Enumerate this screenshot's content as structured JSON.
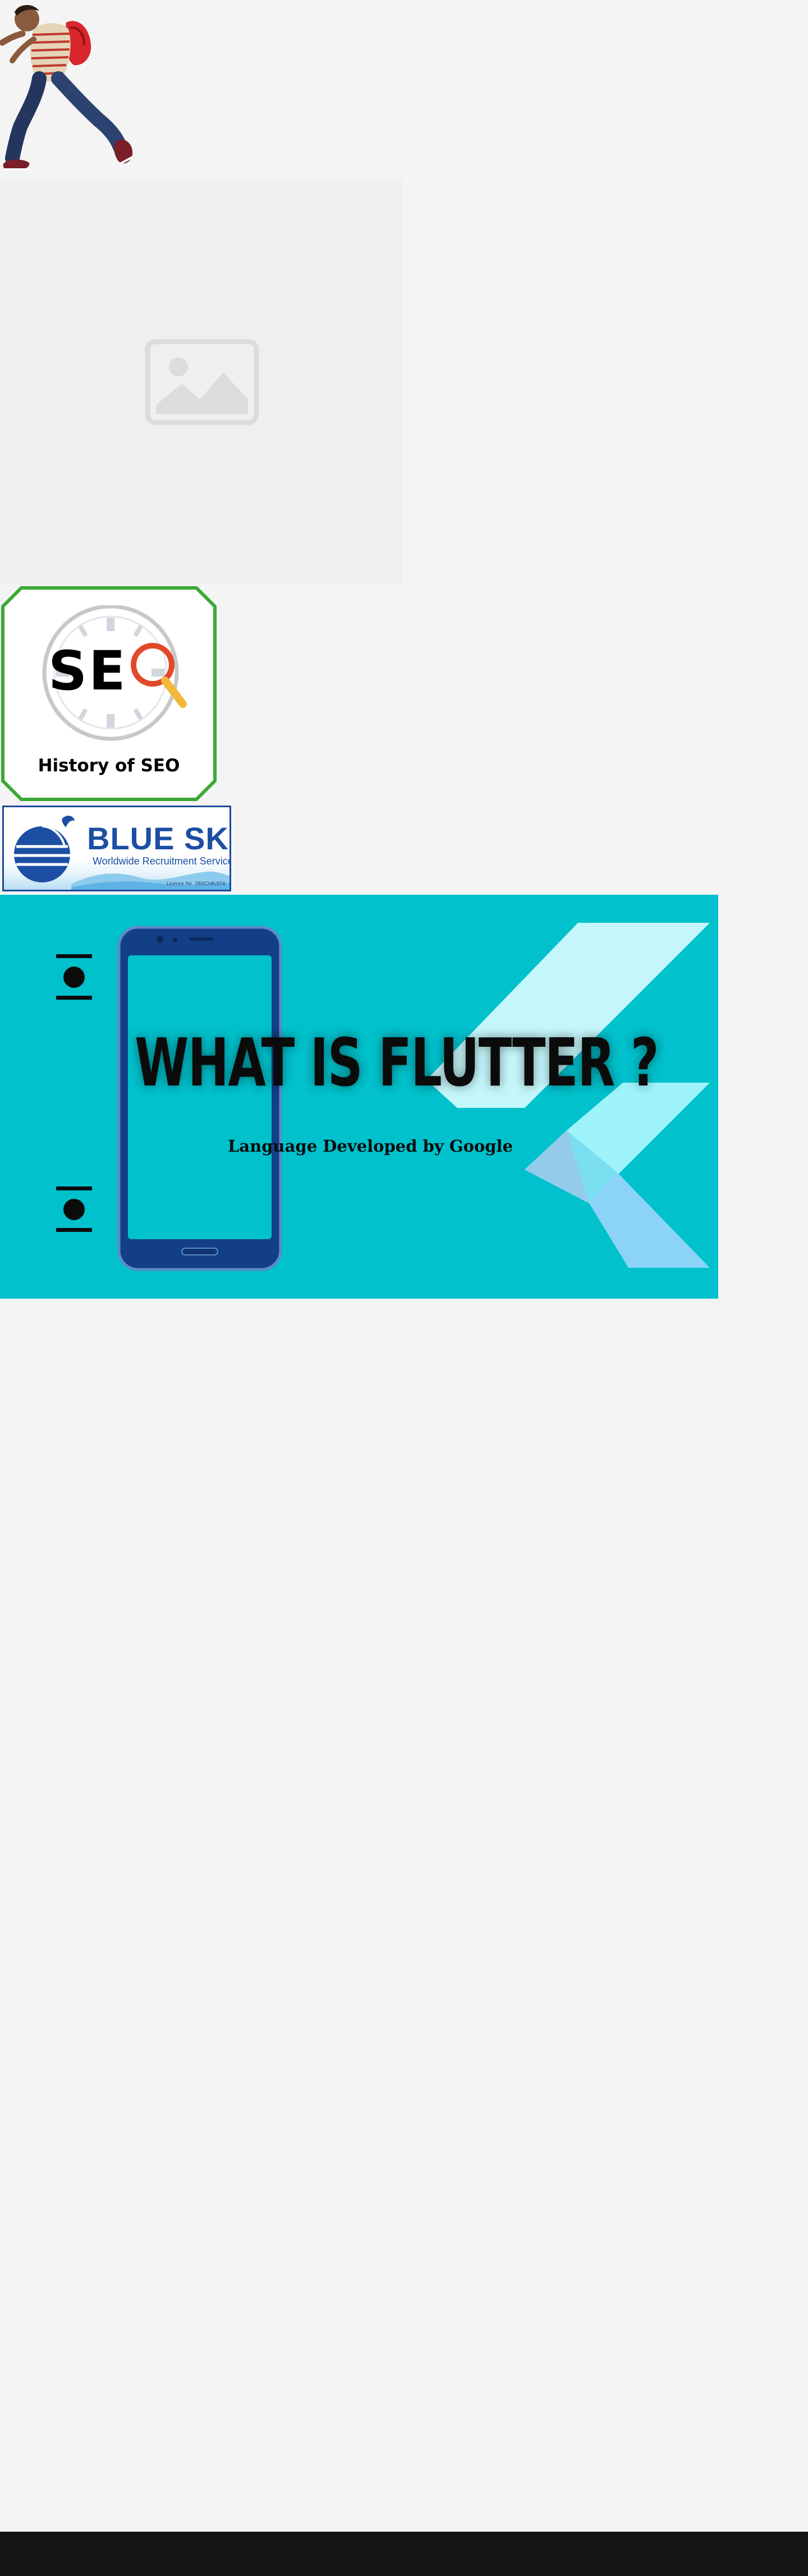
{
  "seo_card": {
    "logo_letters": [
      "S",
      "E"
    ],
    "title": "History of SEO",
    "border_color": "#3aa935"
  },
  "bluesky": {
    "title": "BLUE SKY",
    "subtitle": "Worldwide Recruitment Services",
    "license": "Licence No. 280/CHK/374",
    "brand_color": "#1c4fa3"
  },
  "flutter_banner": {
    "title": "WHAT IS FLUTTER ?",
    "subtitle": "Language Developed by Google",
    "background_color": "#00c1cc"
  },
  "icons": {
    "hero": "jumping-person-illustration",
    "placeholder": "image-placeholder-icon",
    "slider": "slide-indicator-icon"
  },
  "colors": {
    "page_background": "#f4f4f4",
    "footer": "#161616"
  }
}
